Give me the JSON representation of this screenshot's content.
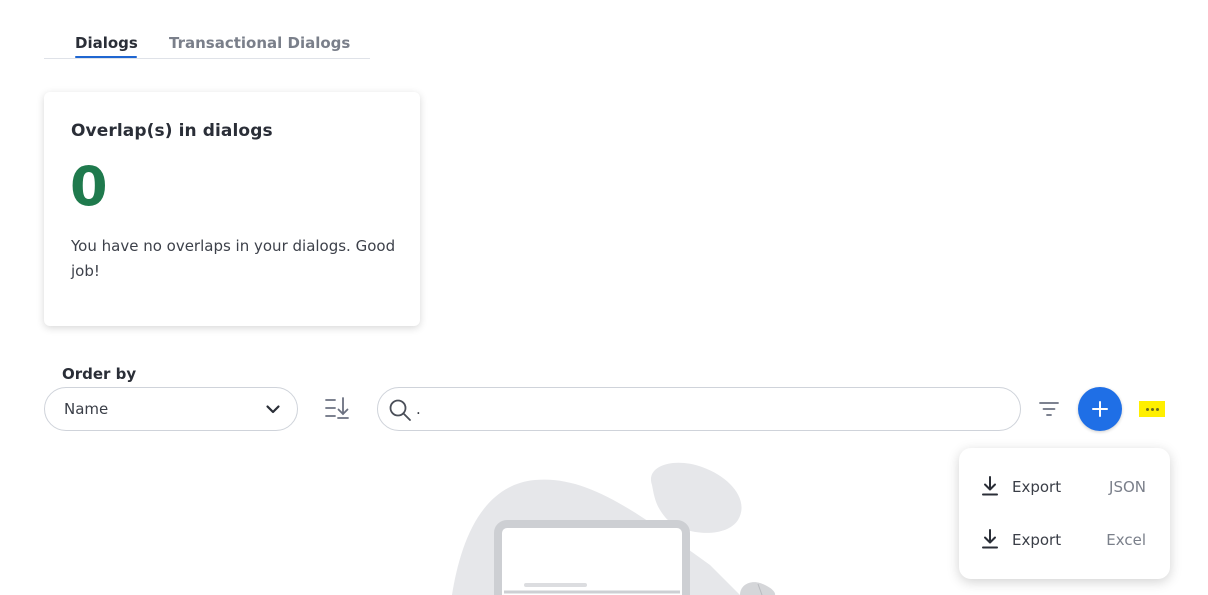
{
  "tabs": [
    {
      "label": "Dialogs",
      "active": true
    },
    {
      "label": "Transactional Dialogs",
      "active": false
    }
  ],
  "overlap_card": {
    "title": "Overlap(s) in dialogs",
    "count": "0",
    "description": "You have no overlaps in your dialogs. Good job!"
  },
  "order": {
    "label": "Order by",
    "selected": "Name"
  },
  "search": {
    "value": "."
  },
  "export_menu": {
    "items": [
      {
        "label": "Export",
        "format": "JSON"
      },
      {
        "label": "Export",
        "format": "Excel"
      }
    ]
  },
  "colors": {
    "accent": "#1f6fe6",
    "count_green": "#1f7a4d",
    "highlight": "#ffef00"
  },
  "icons": [
    "search-icon",
    "chevron-down-icon",
    "sort-icon",
    "filter-icon",
    "plus-icon",
    "more-icon",
    "download-icon"
  ]
}
